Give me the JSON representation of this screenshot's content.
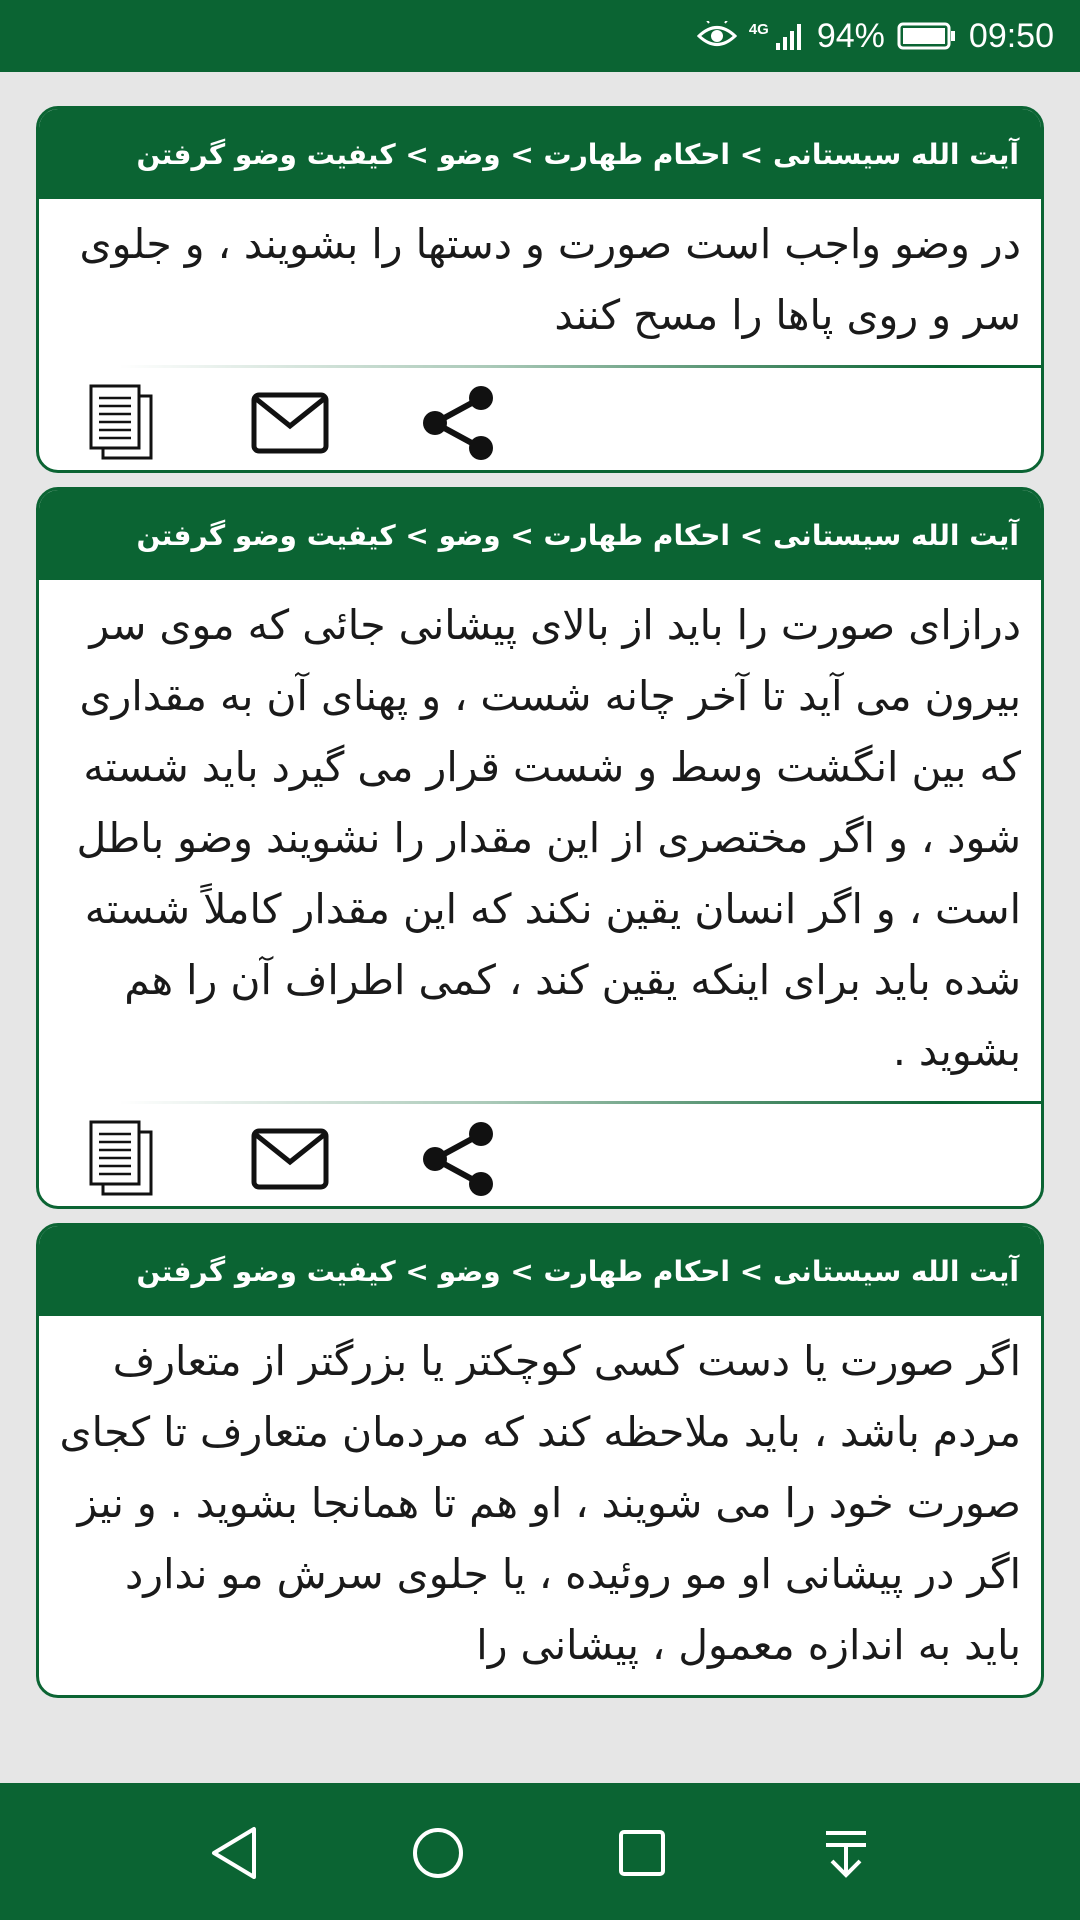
{
  "status_bar": {
    "network": "4G",
    "battery": "94%",
    "time": "09:50",
    "icons": [
      "eye-comfort-icon",
      "signal-icon",
      "battery-icon"
    ]
  },
  "cards": [
    {
      "breadcrumb": "آیت الله سیستانی > احکام طهارت > وضو > کیفیت وضو گرفتن",
      "text": "در وضو واجب است صورت و دستها را بشویند ، و جلوی سر و روی پاها را مسح کنند"
    },
    {
      "breadcrumb": "آیت الله سیستانی > احکام طهارت > وضو > کیفیت وضو گرفتن",
      "text": "درازای صورت را باید از بالای پیشانی جائی که موی سر بیرون می آید تا آخر چانه شست ، و پهنای آن به مقداری که بین انگشت وسط و شست قرار می گیرد باید شسته شود ، و اگر مختصری از این مقدار را نشویند وضو باطل است ، و اگر انسان یقین نکند که این مقدار کاملاً شسته شده باید برای اینکه یقین کند ، کمی اطراف آن را هم بشوید ."
    },
    {
      "breadcrumb": "آیت الله سیستانی > احکام طهارت > وضو > کیفیت وضو گرفتن",
      "text": "اگر صورت یا دست کسی کوچکتر یا بزرگتر از متعارف مردم باشد ، باید ملاحظه کند که مردمان متعارف تا کجای صورت خود را می شویند ، او هم تا همانجا بشوید . و نیز اگر در پیشانی او مو روئیده ، یا جلوی سرش مو ندارد باید به اندازه معمول ، پیشانی را"
    }
  ],
  "card_actions": [
    "copy-icon",
    "mail-icon",
    "share-icon"
  ],
  "nav_bar": [
    "back-icon",
    "home-icon",
    "recents-icon",
    "notification-pulldown-icon"
  ],
  "colors": {
    "primary": "#0b6433",
    "background": "#e6e6e6",
    "card": "#ffffff",
    "text": "#1a1a1a"
  }
}
